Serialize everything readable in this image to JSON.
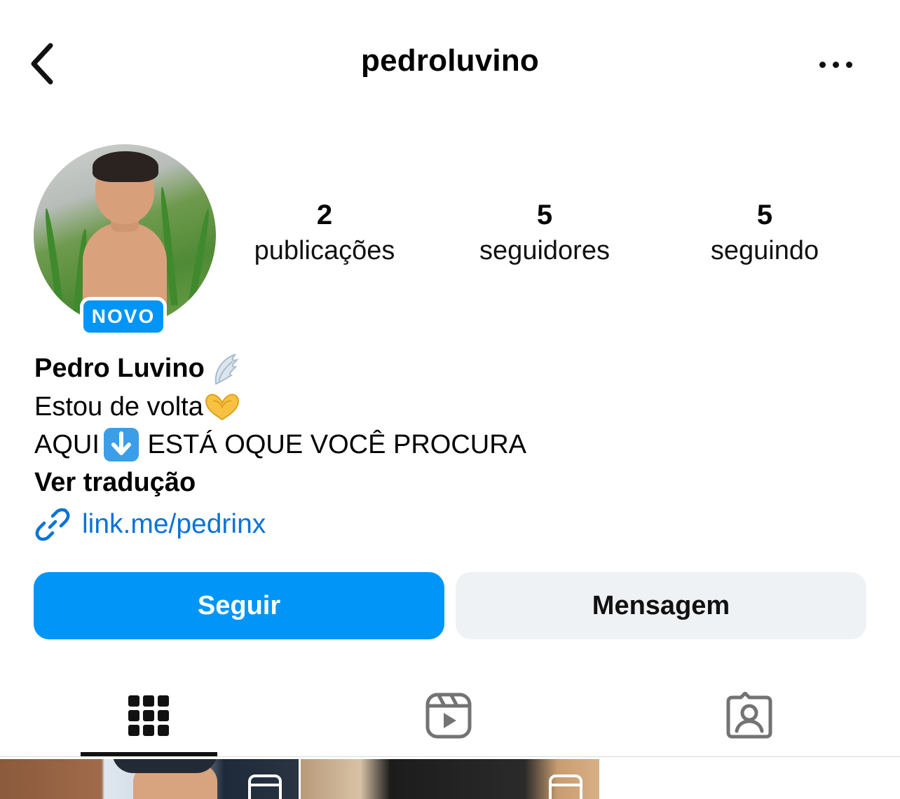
{
  "header": {
    "username": "pedroluvino"
  },
  "profile": {
    "new_badge": "NOVO",
    "stats": {
      "posts_count": "2",
      "posts_label": "publicações",
      "followers_count": "5",
      "followers_label": "seguidores",
      "following_count": "5",
      "following_label": "seguindo"
    },
    "display_name": "Pedro Luvino",
    "bio_line_1": "Estou de volta",
    "bio_line_2_prefix": "AQUI",
    "bio_line_2_suffix": " ESTÁ OQUE VOCÊ PROCURA",
    "translate_label": "Ver tradução",
    "link": "link.me/pedrinx"
  },
  "actions": {
    "follow_label": "Seguir",
    "message_label": "Mensagem"
  },
  "tabs": [
    {
      "icon": "grid-icon",
      "active": true
    },
    {
      "icon": "reels-icon",
      "active": false
    },
    {
      "icon": "tagged-icon",
      "active": false
    }
  ],
  "posts": [
    {
      "type": "reel",
      "icon": "reels-icon"
    },
    {
      "type": "reel",
      "icon": "reels-icon"
    }
  ],
  "colors": {
    "primary_blue": "#0095f6",
    "link_blue": "#0a73d6",
    "secondary_button": "#eff2f5"
  }
}
